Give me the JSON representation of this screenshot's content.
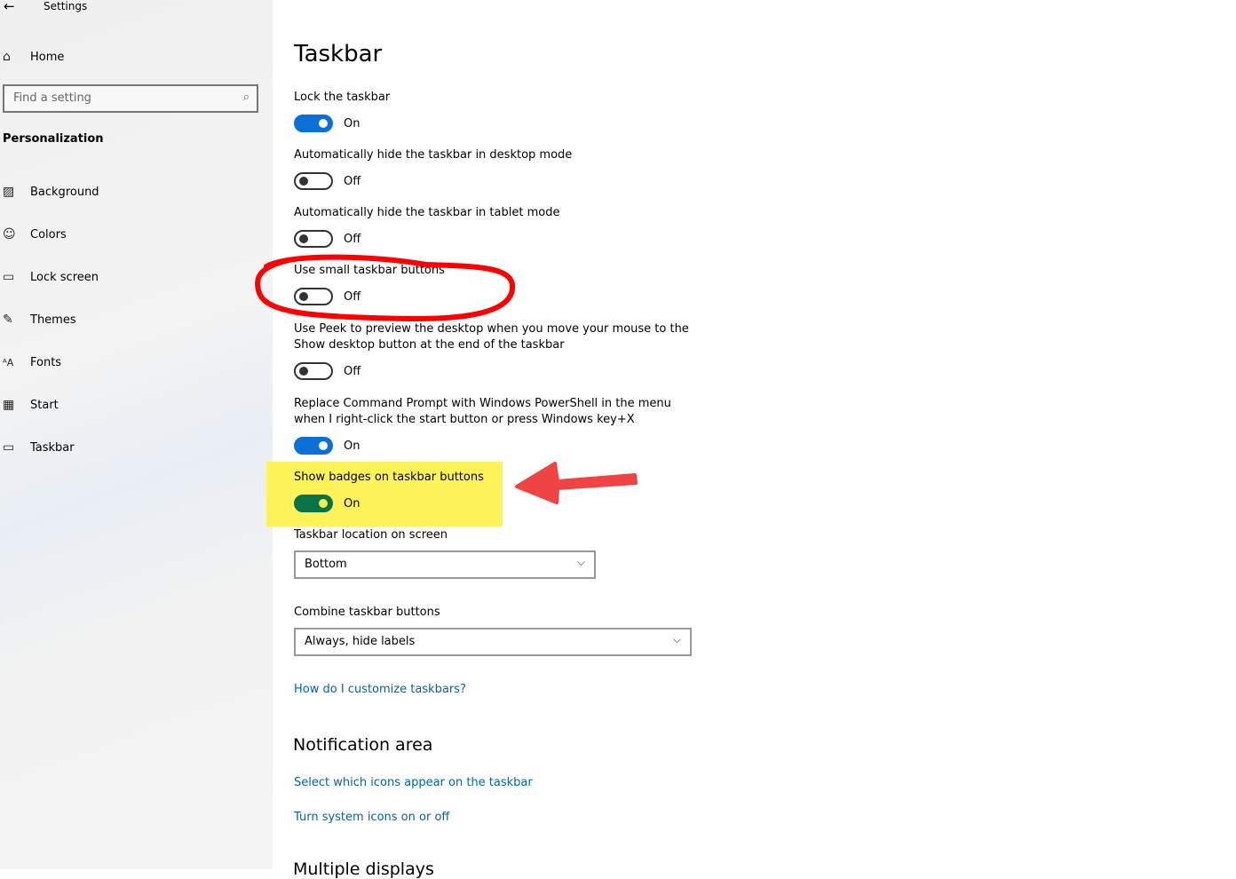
{
  "window": {
    "title": "Settings"
  },
  "sidebar": {
    "home": "Home",
    "search_placeholder": "Find a setting",
    "section": "Personalization",
    "items": [
      {
        "label": "Background",
        "icon": "picture-icon"
      },
      {
        "label": "Colors",
        "icon": "palette-icon"
      },
      {
        "label": "Lock screen",
        "icon": "lock-screen-icon"
      },
      {
        "label": "Themes",
        "icon": "themes-icon"
      },
      {
        "label": "Fonts",
        "icon": "fonts-icon"
      },
      {
        "label": "Start",
        "icon": "start-icon"
      },
      {
        "label": "Taskbar",
        "icon": "taskbar-icon"
      }
    ]
  },
  "main": {
    "title": "Taskbar",
    "settings": [
      {
        "label": "Lock the taskbar",
        "state": "On"
      },
      {
        "label": "Automatically hide the taskbar in desktop mode",
        "state": "Off"
      },
      {
        "label": "Automatically hide the taskbar in tablet mode",
        "state": "Off"
      },
      {
        "label": "Use small taskbar buttons",
        "state": "Off"
      },
      {
        "label": "Use Peek to preview the desktop when you move your mouse to the",
        "label2": "Show desktop button at the end of the taskbar",
        "state": "Off"
      },
      {
        "label": "Replace Command Prompt with Windows PowerShell in the menu",
        "label2": "when I right-click the start button or press Windows key+X",
        "state": "On"
      },
      {
        "label": "Show badges on taskbar buttons",
        "state": "On"
      }
    ],
    "location_label": "Taskbar location on screen",
    "location_value": "Bottom",
    "combine_label": "Combine taskbar buttons",
    "combine_value": "Always, hide labels",
    "help_link": "How do I customize taskbars?",
    "notification_heading": "Notification area",
    "notif_links": [
      "Select which icons appear on the taskbar",
      "Turn system icons on or off"
    ],
    "next_heading": "Multiple displays"
  },
  "annotations": {
    "circle_color": "#ff0000",
    "highlight_color": "#fff35a",
    "arrow_color": "#f04444"
  }
}
